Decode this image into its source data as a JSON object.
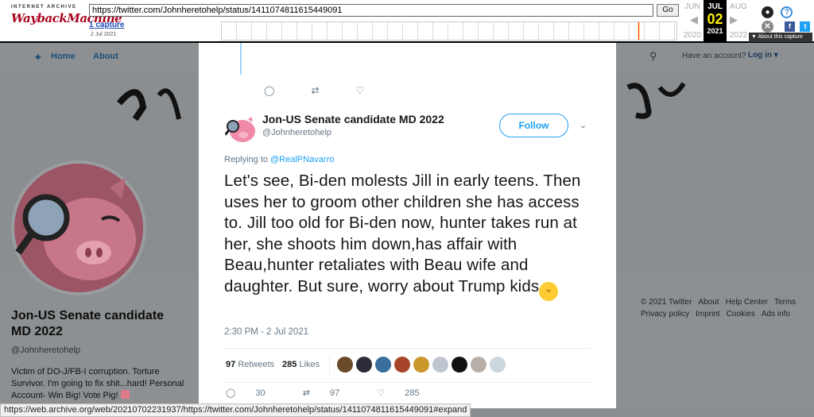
{
  "wayback": {
    "logo_top": "INTERNET ARCHIVE",
    "logo_main": "WaybackMachine",
    "url": "https://twitter.com/Johnheretohelp/status/1411074811615449091",
    "go_label": "Go",
    "captures": "1 capture",
    "capture_date": "2 Jul 2021",
    "prev_month": "JUN",
    "cur_month": "JUL",
    "next_month": "AUG",
    "cur_day": "02",
    "prev_year": "2020",
    "cur_year": "2021",
    "next_year": "2022",
    "about": "About this capture"
  },
  "nav": {
    "home": "Home",
    "about": "About",
    "have_account": "Have an account?",
    "login": "Log in"
  },
  "profile": {
    "name": "Jon-US Senate candidate MD 2022",
    "handle": "@Johnheretohelp",
    "bio": "Victim of DO-J/FB-I corruption. Torture Survivor. I'm going to fix shit...hard! Personal Account- Win Big! Vote Pig!"
  },
  "footer": {
    "links": [
      "© 2021 Twitter",
      "About",
      "Help Center",
      "Terms",
      "Privacy policy",
      "Imprint",
      "Cookies",
      "Ads info"
    ]
  },
  "tweet": {
    "name": "Jon-US Senate candidate MD 2022",
    "handle": "@Johnheretohelp",
    "follow": "Follow",
    "replying_prefix": "Replying to",
    "replying_to": "@RealPNavarro",
    "text": "Let's see, Bi-den molests Jill in early teens. Then uses her to groom other children she has access to. Jill too old for Bi-den now, hunter takes run at her, she shoots him down,has affair with Beau,hunter retaliates with Beau wife and daughter. But sure, worry about Trump kids",
    "time": "2:30 PM - 2 Jul 2021",
    "retweets_count": "97",
    "retweets_label": "Retweets",
    "likes_count": "285",
    "likes_label": "Likes",
    "actions": {
      "replies": "30",
      "retweets": "97",
      "likes": "285"
    }
  },
  "status_url": "https://web.archive.org/web/20210702231937/https://twitter.com/Johnheretohelp/status/1411074811615449091#expand"
}
